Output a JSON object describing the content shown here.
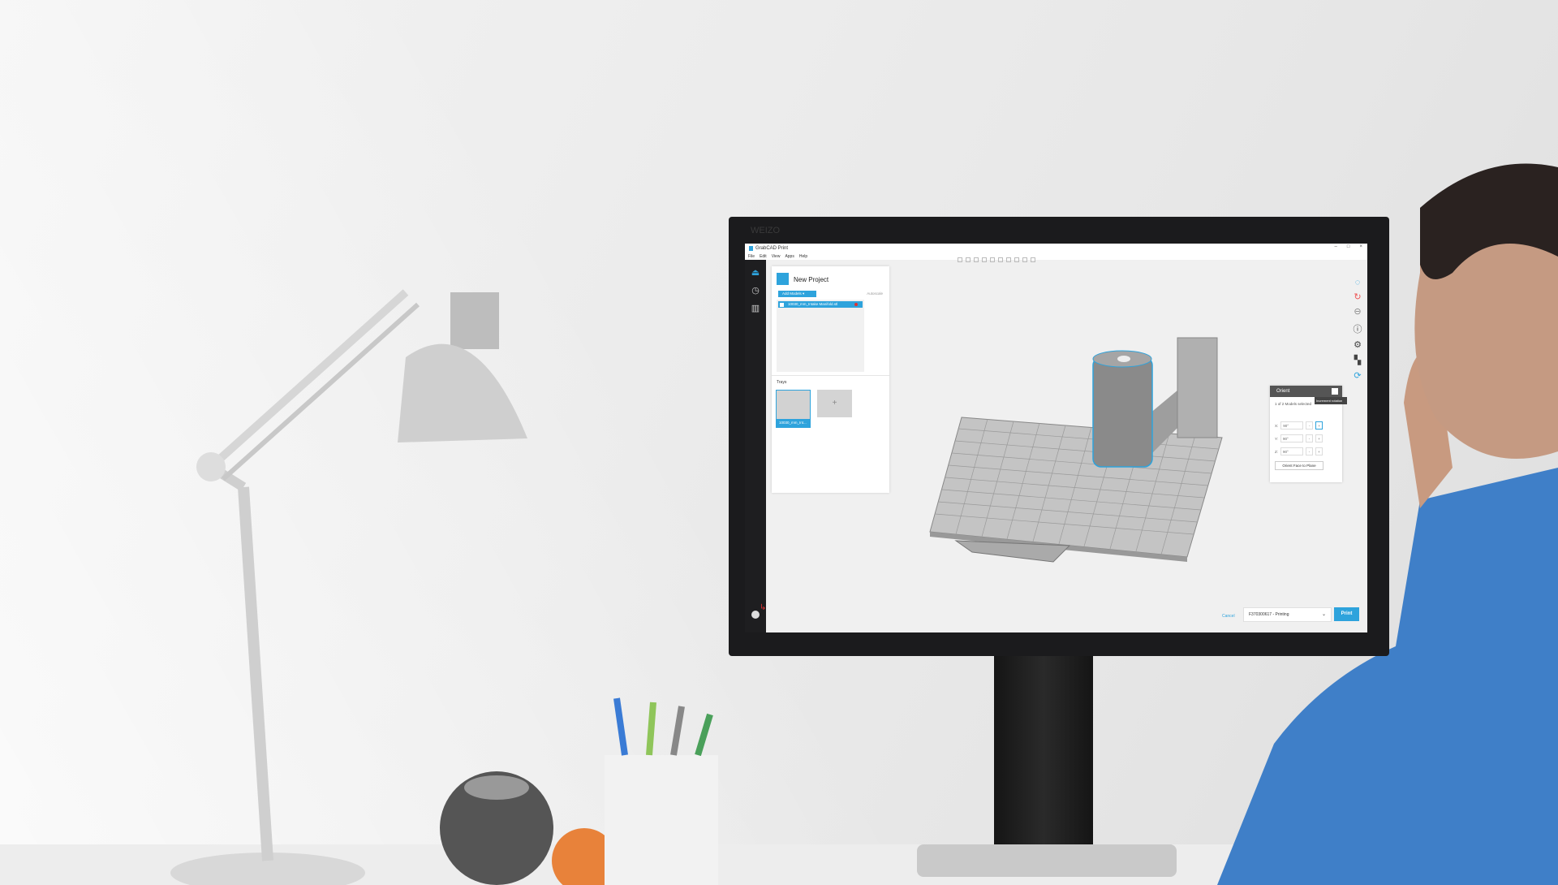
{
  "monitor": {
    "brand": "WEIZO"
  },
  "app": {
    "title": "GrabCAD Print",
    "window_controls": [
      "–",
      "□",
      "×"
    ],
    "menu": [
      "File",
      "Edit",
      "View",
      "Apps",
      "Help"
    ],
    "project": {
      "title": "New Project",
      "add_models": "Add Models",
      "arrange": "Autoscale",
      "file": "10030_mm_Intake Manifold.stl",
      "trays_label": "Trays",
      "tray_name": "10030_mm_Int...",
      "add_tray": "+"
    },
    "orient": {
      "title": "Orient",
      "tooltip": "Increment rotation",
      "selection": "1 of 2 Models selected",
      "rows": [
        {
          "axis": "X:",
          "value": "90°"
        },
        {
          "axis": "Y:",
          "value": "90°"
        },
        {
          "axis": "Z:",
          "value": "90°"
        }
      ],
      "minus": "-",
      "plus": "+",
      "face_to_plane": "Orient Face to Plane"
    },
    "footer": {
      "cancel": "Cancel",
      "printer": "F370300617 - Printing",
      "print": "Print"
    }
  },
  "colors": {
    "accent": "#2ea3dc",
    "sidebar": "#1e1e20"
  }
}
